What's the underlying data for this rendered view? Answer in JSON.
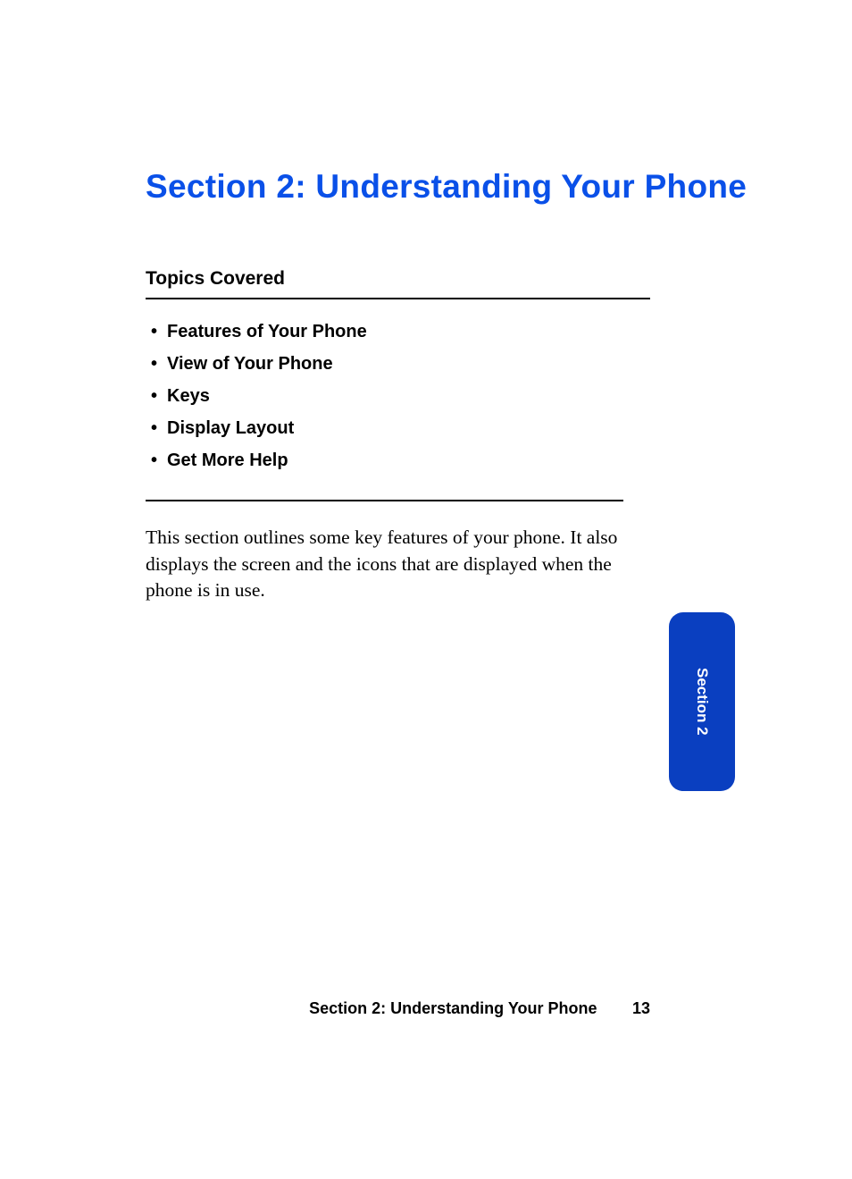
{
  "title": "Section 2: Understanding Your Phone",
  "topics": {
    "heading": "Topics Covered",
    "items": [
      "Features of Your Phone",
      "View of Your Phone",
      "Keys",
      "Display Layout",
      "Get More Help"
    ]
  },
  "intro": "This section outlines some key features of your phone. It also displays the screen and the icons that are displayed when the phone is in use.",
  "tab": {
    "label": "Section 2"
  },
  "footer": {
    "title": "Section 2: Understanding Your Phone",
    "page": "13"
  }
}
